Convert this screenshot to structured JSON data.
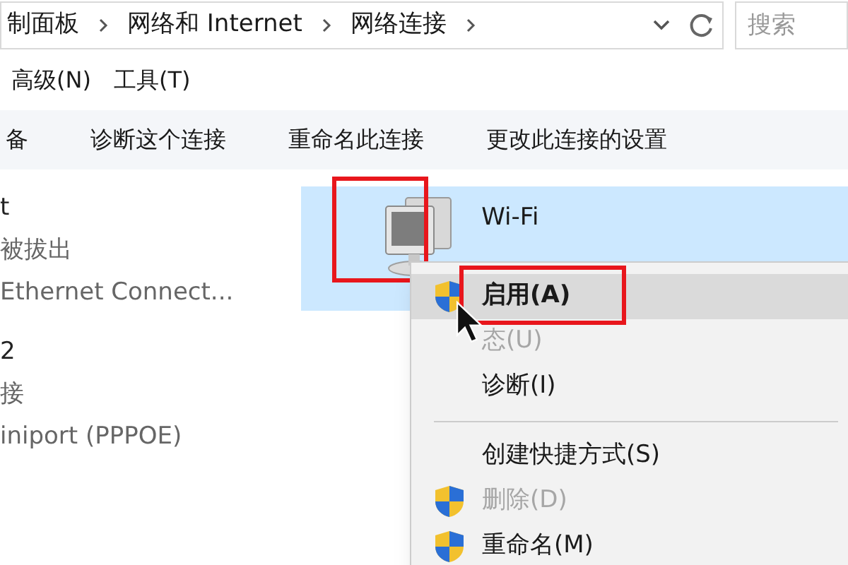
{
  "address_bar": {
    "breadcrumbs": [
      "制面板",
      "网络和 Internet",
      "网络连接"
    ],
    "search": {
      "placeholder": "搜索"
    }
  },
  "menu_bar": [
    "高级(N)",
    "工具(T)"
  ],
  "command_bar": [
    "备",
    "诊断这个连接",
    "重命名此连接",
    "更改此连接的设置"
  ],
  "connections": [
    {
      "name": "t",
      "status": "被拔出",
      "device": "Ethernet Connect...",
      "selected": false
    },
    {
      "name": "2",
      "status": "接",
      "device": "iniport (PPPOE)",
      "selected": false
    },
    {
      "name": "Wi-Fi",
      "selected": true
    }
  ],
  "context_menu": [
    {
      "kind": "item",
      "label": "启用(A)",
      "shield": true,
      "default": true,
      "disabled": false,
      "selected": true
    },
    {
      "kind": "item",
      "label": "态(U)",
      "shield": false,
      "default": false,
      "disabled": true,
      "selected": false
    },
    {
      "kind": "item",
      "label": "诊断(I)",
      "shield": false,
      "default": false,
      "disabled": false,
      "selected": false
    },
    {
      "kind": "separator"
    },
    {
      "kind": "item",
      "label": "创建快捷方式(S)",
      "shield": false,
      "default": false,
      "disabled": false,
      "selected": false
    },
    {
      "kind": "item",
      "label": "删除(D)",
      "shield": true,
      "default": false,
      "disabled": true,
      "selected": false
    },
    {
      "kind": "item",
      "label": "重命名(M)",
      "shield": true,
      "default": false,
      "disabled": false,
      "selected": false
    }
  ]
}
